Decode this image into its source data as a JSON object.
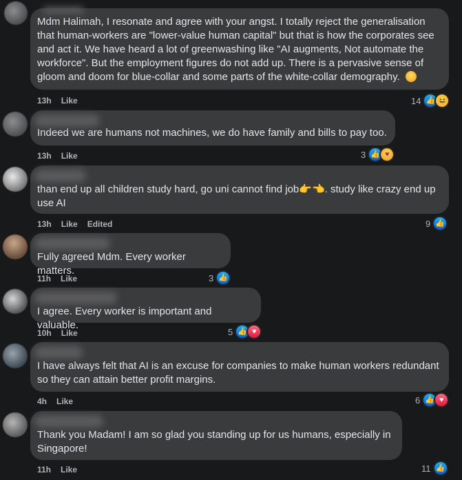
{
  "comments": [
    {
      "text": "Mdm Halimah, I resonate and agree with your angst. I totally reject the generalisation that human-workers are \"lower-value human capital\" but that is how the corporates see and act it. We have heard a lot of greenwashing like \"AI augments, Not automate the workforce\". But the employment figures do not add up. There is a pervasive sense of gloom and doom for blue-collar and some parts of the white-collar demography.",
      "time": "13h",
      "like": "Like",
      "edited": "",
      "reaction_count": "14",
      "reactions": [
        "like-icon",
        "haha-icon"
      ]
    },
    {
      "text": "Indeed we are humans not machines, we do have family and bills to pay too.",
      "time": "13h",
      "like": "Like",
      "edited": "",
      "reaction_count": "3",
      "reactions": [
        "like-icon",
        "care-icon"
      ]
    },
    {
      "text_a": "than end up all children study hard, go uni cannot find job",
      "text_b": ". study like crazy end up use AI",
      "time": "13h",
      "like": "Like",
      "edited": "Edited",
      "reaction_count": "9",
      "reactions": [
        "like-icon"
      ]
    },
    {
      "text": "Fully agreed Mdm. Every worker matters.",
      "time": "11h",
      "like": "Like",
      "edited": "",
      "reaction_count": "3",
      "reactions": [
        "like-icon"
      ]
    },
    {
      "text": "I agree. Every worker is important and valuable.",
      "time": "10h",
      "like": "Like",
      "edited": "",
      "reaction_count": "5",
      "reactions": [
        "like-icon",
        "love-icon"
      ]
    },
    {
      "text": "I have always felt that AI is an excuse for companies to make human workers redundant so they can attain better profit margins.",
      "time": "4h",
      "like": "Like",
      "edited": "",
      "reaction_count": "6",
      "reactions": [
        "like-icon",
        "love-icon"
      ]
    },
    {
      "text": "Thank you Madam! I am so glad you standing up for us humans, especially in Singapore!",
      "time": "11h",
      "like": "Like",
      "edited": "",
      "reaction_count": "11",
      "reactions": [
        "like-icon"
      ]
    }
  ],
  "colors": {
    "background": "#18191a",
    "bubble": "#3a3b3c",
    "text": "#e4e6eb",
    "meta": "#b0b3b8",
    "like_blue": "#1877f2",
    "love_red": "#f33e58"
  }
}
